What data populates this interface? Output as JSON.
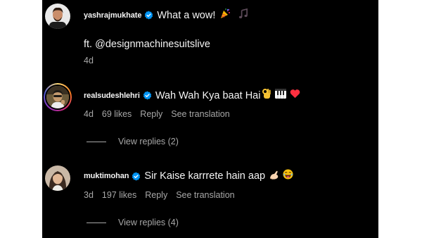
{
  "comments": [
    {
      "username": "yashrajmukhate",
      "text": "What a wow!",
      "extra_line": "ft. @designmachinesuitslive",
      "time": "4d",
      "emoji_icons": [
        "party-popper-icon",
        "music-note-icon"
      ]
    },
    {
      "username": "realsudeshlehri",
      "text": "Wah Wah Kya baat Hai",
      "time": "4d",
      "likes": "69 likes",
      "reply": "Reply",
      "translate": "See translation",
      "view_replies": "View replies (2)",
      "emoji_icons": [
        "ok-hand-icon",
        "piano-keys-icon",
        "red-heart-icon"
      ]
    },
    {
      "username": "muktimohan",
      "text": "Sir Kaise karrrete hain aap",
      "time": "3d",
      "likes": "197 likes",
      "reply": "Reply",
      "translate": "See translation",
      "view_replies": "View replies (4)",
      "emoji_icons": [
        "pointing-hand-icon",
        "laughing-face-icon"
      ]
    }
  ],
  "colors": {
    "background": "#000000",
    "primary_text": "#f5f5f5",
    "secondary_text": "#a8a8a8",
    "verified_blue": "#0095f6",
    "heart_red": "#ff3040"
  }
}
